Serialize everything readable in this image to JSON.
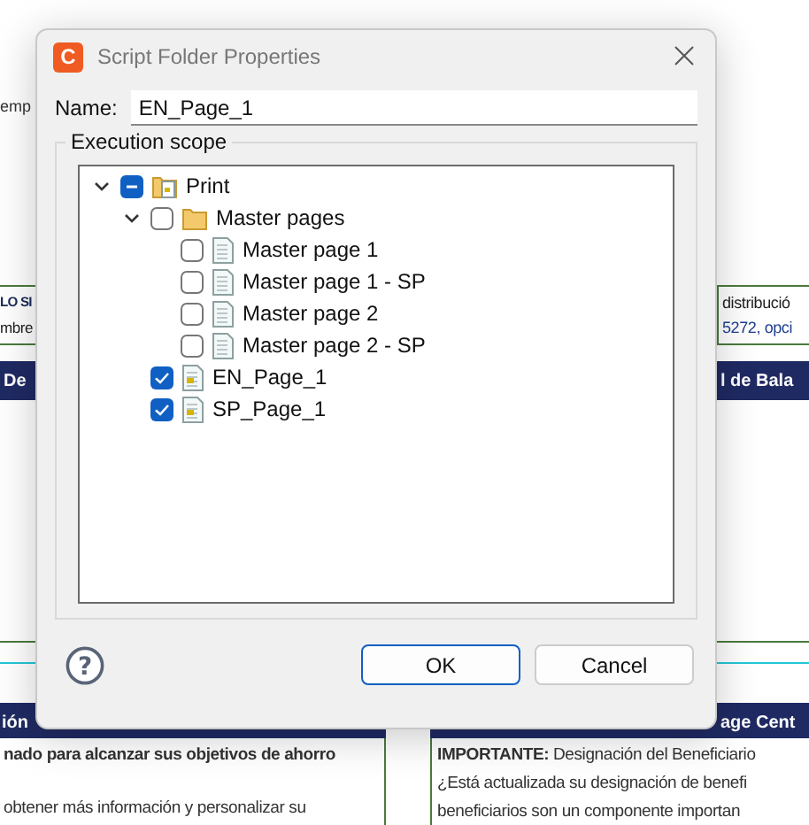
{
  "background": {
    "top_left": "emp",
    "left_box": [
      {
        "text": "LO SI",
        "bold": true
      },
      {
        "text": "mbre",
        "bold": false
      }
    ],
    "right_box": [
      {
        "text": "distribució",
        "kind": "plain"
      },
      {
        "text": "5272, opci",
        "kind": "link"
      }
    ],
    "banner_left": "De",
    "banner_right": "l de Bala",
    "bottom_left_banner": "ión",
    "bottom_left_lines": [
      {
        "text": "nado para alcanzar sus objetivos de ahorro",
        "bold": true
      },
      {
        "text": "obtener más información y personalizar su",
        "bold": false
      }
    ],
    "bottom_right_banner": "age Cent",
    "bottom_right_lines": [
      "**IMPORTANTE:** Designación del Beneficiario",
      "¿Está actualizada su designación de benefi",
      "beneficiarios son un componente importan"
    ]
  },
  "dialog": {
    "app_icon_letter": "C",
    "title": "Script Folder Properties",
    "name_label": "Name:",
    "name_value": "EN_Page_1",
    "group_label": "Execution scope",
    "tree": [
      {
        "label": "Print",
        "kind": "folder-script",
        "checked": false,
        "mixed": true,
        "expanded": true,
        "children": [
          {
            "label": "Master pages",
            "kind": "folder",
            "checked": false,
            "mixed": false,
            "expanded": true,
            "children": [
              {
                "label": "Master page 1",
                "kind": "page",
                "checked": false,
                "mixed": false
              },
              {
                "label": "Master page 1 - SP",
                "kind": "page",
                "checked": false,
                "mixed": false
              },
              {
                "label": "Master page 2",
                "kind": "page",
                "checked": false,
                "mixed": false
              },
              {
                "label": "Master page 2 - SP",
                "kind": "page",
                "checked": false,
                "mixed": false
              }
            ]
          },
          {
            "label": "EN_Page_1",
            "kind": "script-page",
            "checked": true,
            "mixed": false
          },
          {
            "label": "SP_Page_1",
            "kind": "script-page",
            "checked": true,
            "mixed": false
          }
        ]
      }
    ],
    "help_glyph": "?",
    "buttons": [
      {
        "label": "OK",
        "default": true
      },
      {
        "label": "Cancel",
        "default": false
      }
    ]
  }
}
